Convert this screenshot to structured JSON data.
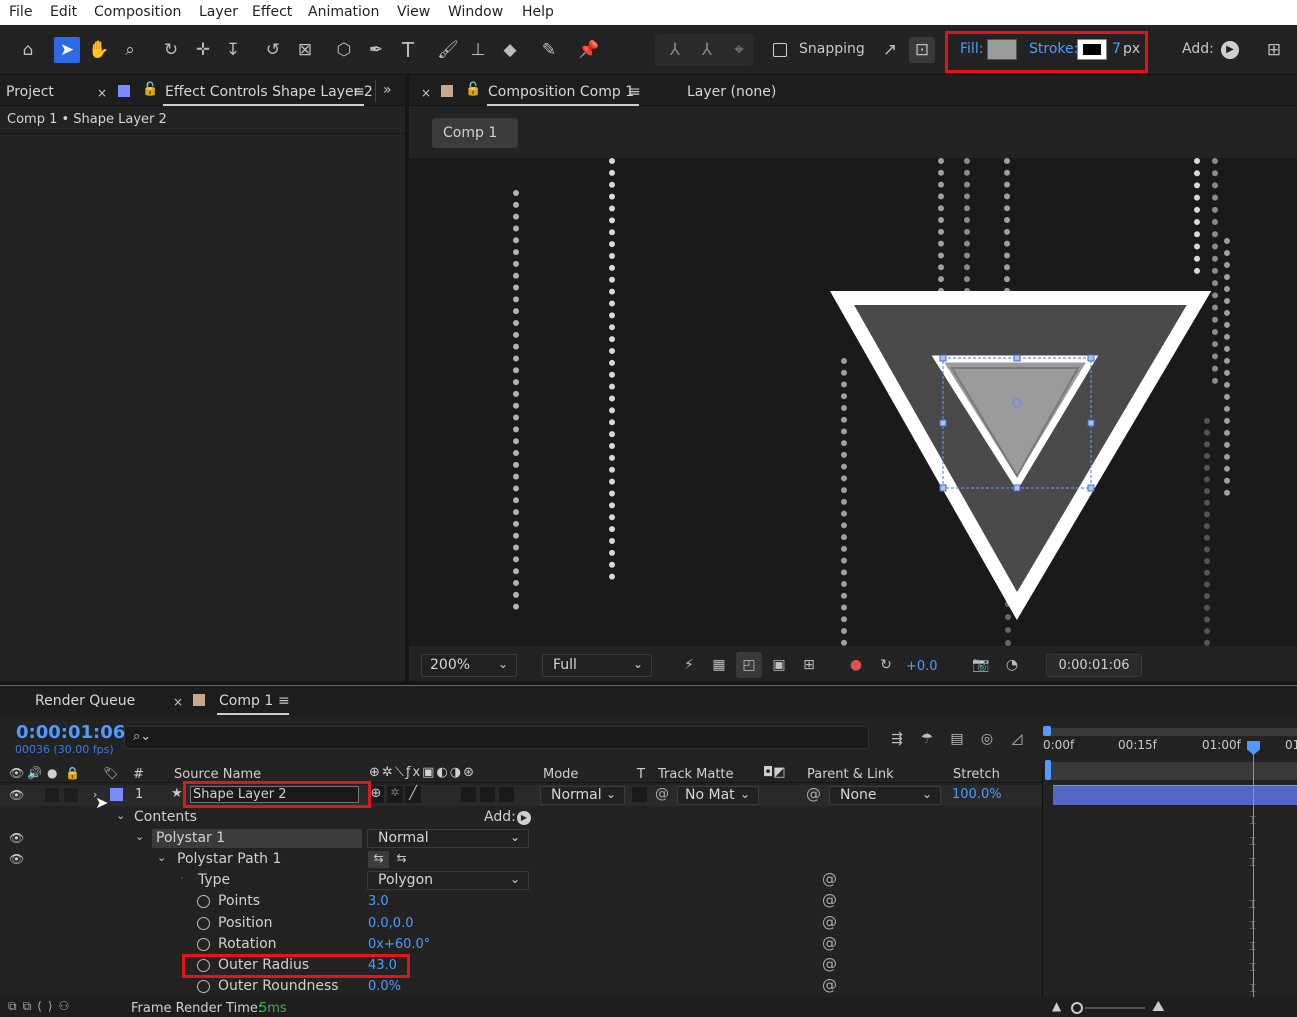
{
  "menu": [
    "File",
    "Edit",
    "Composition",
    "Layer",
    "Effect",
    "Animation",
    "View",
    "Window",
    "Help"
  ],
  "toolbar": {
    "snapping_label": "Snapping",
    "fill_label": "Fill:",
    "stroke_label": "Stroke:",
    "stroke_width": "7",
    "stroke_unit": "px",
    "add_label": "Add:",
    "fill_color": "#9b9b9b"
  },
  "left_panel": {
    "project_tab": "Project",
    "effect_controls_tab": "Effect Controls Shape Layer 2",
    "breadcrumb": "Comp 1 • Shape Layer 2"
  },
  "viewer": {
    "comp_tab": "Composition Comp 1",
    "layer_tab": "Layer (none)",
    "comp_button": "Comp 1",
    "zoom": "200%",
    "resolution": "Full",
    "exposure": "+0.0",
    "timecode": "0:00:01:06"
  },
  "timeline": {
    "render_queue_tab": "Render Queue",
    "comp_tab": "Comp 1",
    "current_time": "0:00:01:06",
    "frame_info": "00036 (30.00 fps)",
    "search_placeholder": "",
    "ruler": [
      "0:00f",
      "00:15f",
      "01:00f",
      "01"
    ],
    "columns": {
      "number": "#",
      "source_name": "Source Name",
      "mode": "Mode",
      "t": "T",
      "track_matte": "Track Matte",
      "parent_link": "Parent & Link",
      "stretch": "Stretch"
    },
    "layer": {
      "number": "1",
      "name": "Shape Layer 2",
      "mode": "Normal",
      "track_matte": "No Mat",
      "parent": "None",
      "stretch": "100.0%"
    },
    "contents_label": "Contents",
    "contents_add": "Add:",
    "polystar_label": "Polystar 1",
    "polystar_mode": "Normal",
    "polystar_path_label": "Polystar Path 1",
    "properties": [
      {
        "label": "Type",
        "value": "Polygon"
      },
      {
        "label": "Points",
        "value": "3.0"
      },
      {
        "label": "Position",
        "value": "0.0,0.0"
      },
      {
        "label": "Rotation",
        "value": "0x+60.0°"
      },
      {
        "label": "Outer Radius",
        "value": "43.0"
      },
      {
        "label": "Outer Roundness",
        "value": "0.0%"
      }
    ],
    "frame_render_label": "Frame Render Time:",
    "frame_render_value": "5ms"
  },
  "colors": {
    "accent": "#2d6ae8",
    "highlight": "#e0161c",
    "value_blue": "#4f9bff",
    "layer_color": "#7a8cff",
    "comp_color": "#c8a98c"
  }
}
